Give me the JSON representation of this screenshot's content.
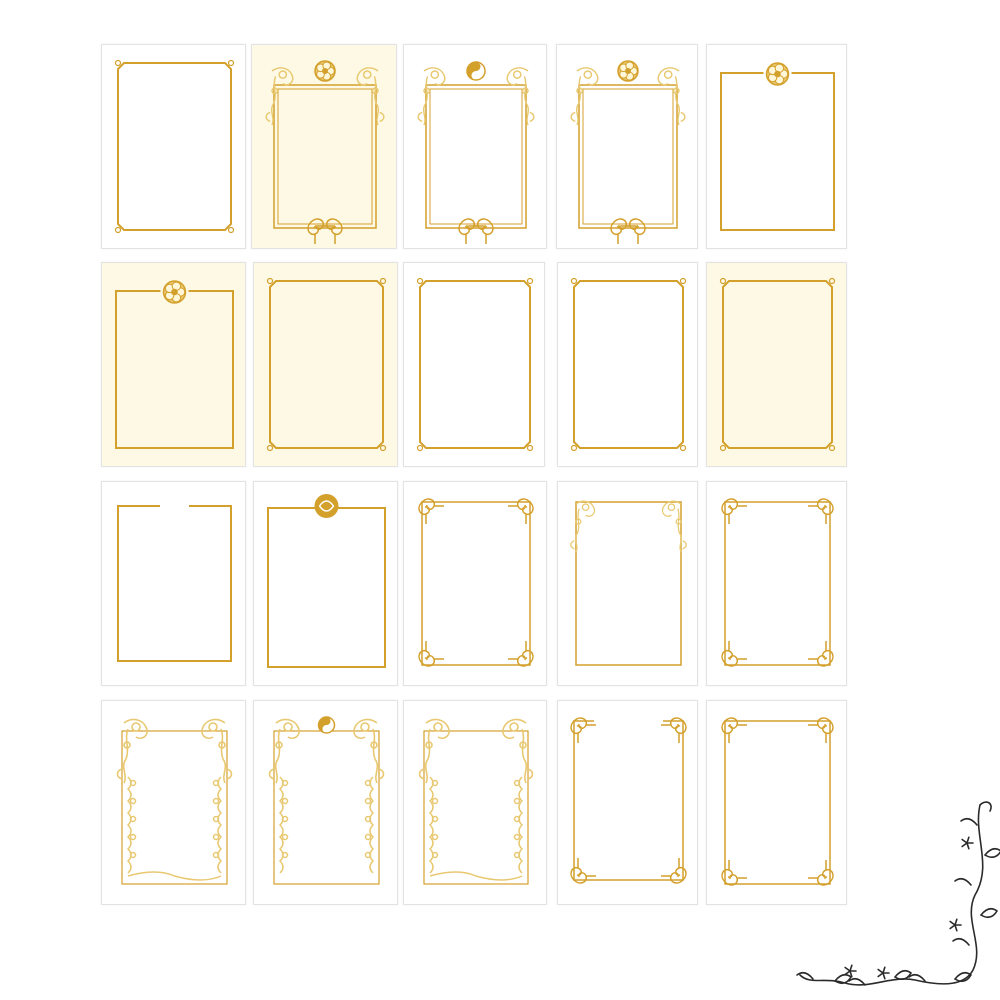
{
  "colors": {
    "gold": "#d4a02c",
    "gold_light": "#e8c870",
    "white_paper": "#ffffff",
    "cream_paper": "#fdf9e4",
    "vine_ink": "#2b2b2b"
  },
  "cards": [
    {
      "paper": "white",
      "style": "notched-corners"
    },
    {
      "paper": "cream",
      "style": "flower-medallion-floral"
    },
    {
      "paper": "white",
      "style": "yinyang-floral"
    },
    {
      "paper": "white",
      "style": "flower-medallion-floral"
    },
    {
      "paper": "white",
      "style": "flower-top"
    },
    {
      "paper": "cream",
      "style": "flower-top"
    },
    {
      "paper": "cream",
      "style": "notched-corners"
    },
    {
      "paper": "white",
      "style": "notched-corners"
    },
    {
      "paper": "white",
      "style": "notched-corners"
    },
    {
      "paper": "cream",
      "style": "notched-corners"
    },
    {
      "paper": "white",
      "style": "gap-top"
    },
    {
      "paper": "white",
      "style": "emblem-top"
    },
    {
      "paper": "white",
      "style": "scroll-corners"
    },
    {
      "paper": "white",
      "style": "floral-top-corners"
    },
    {
      "paper": "white",
      "style": "scroll-corners"
    },
    {
      "paper": "white",
      "style": "phoenix-vines"
    },
    {
      "paper": "white",
      "style": "yinyang-vines"
    },
    {
      "paper": "white",
      "style": "phoenix-vines"
    },
    {
      "paper": "white",
      "style": "gap-corners"
    },
    {
      "paper": "white",
      "style": "scroll-corners"
    }
  ],
  "decoration": {
    "icon": "corner-vine-ornament-icon"
  }
}
